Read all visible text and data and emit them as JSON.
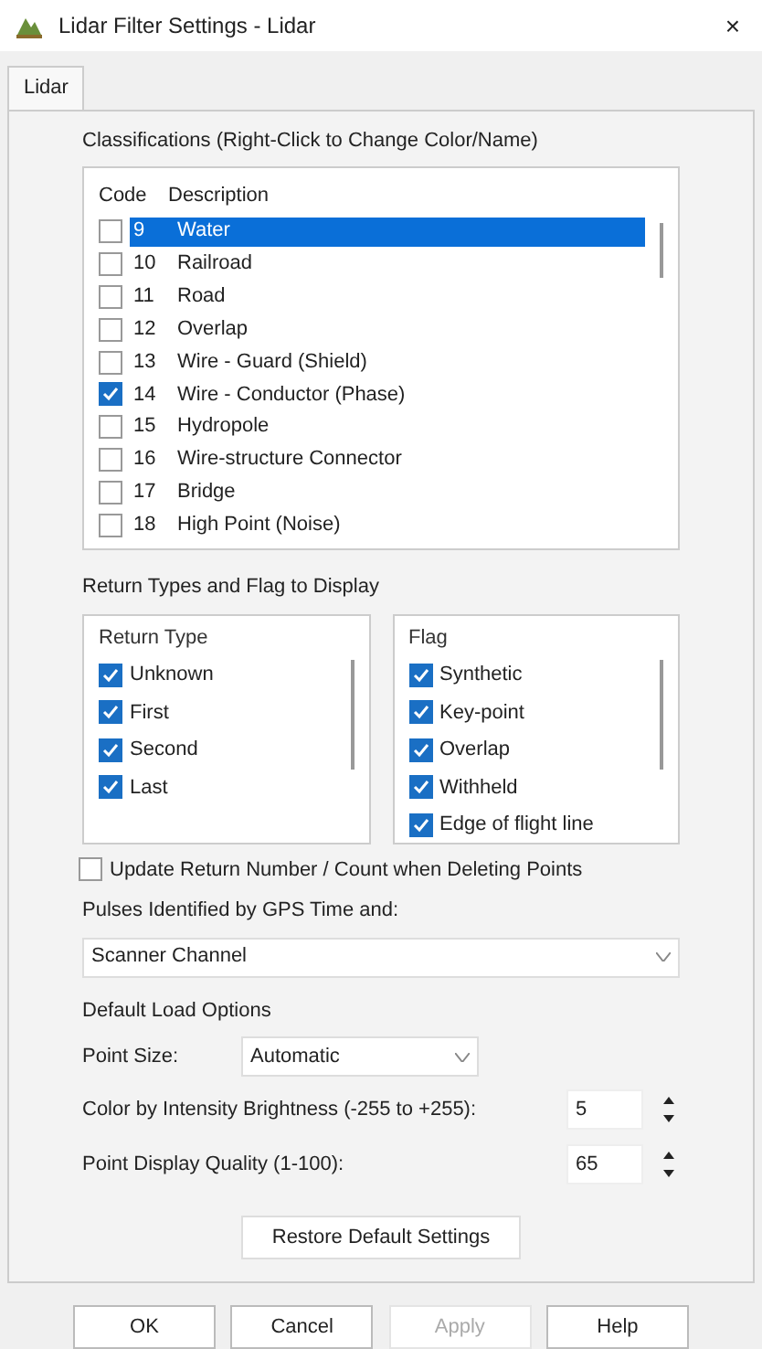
{
  "window": {
    "title": "Lidar Filter Settings - Lidar",
    "close": "×"
  },
  "tab": {
    "label": "Lidar"
  },
  "classifications": {
    "label": "Classifications (Right-Click to Change Color/Name)",
    "columns": [
      "Code",
      "Description"
    ],
    "rows": [
      {
        "code": "9",
        "description": "Water",
        "checked": false,
        "selected": true
      },
      {
        "code": "10",
        "description": "Railroad",
        "checked": false,
        "selected": false
      },
      {
        "code": "11",
        "description": "Road",
        "checked": false,
        "selected": false
      },
      {
        "code": "12",
        "description": "Overlap",
        "checked": false,
        "selected": false
      },
      {
        "code": "13",
        "description": "Wire - Guard (Shield)",
        "checked": false,
        "selected": false
      },
      {
        "code": "14",
        "description": "Wire - Conductor (Phase)",
        "checked": true,
        "selected": false
      },
      {
        "code": "15",
        "description": "Hydropole",
        "checked": false,
        "selected": false
      },
      {
        "code": "16",
        "description": "Wire-structure Connector",
        "checked": false,
        "selected": false
      },
      {
        "code": "17",
        "description": "Bridge",
        "checked": false,
        "selected": false
      },
      {
        "code": "18",
        "description": "High Point (Noise)",
        "checked": false,
        "selected": false
      }
    ]
  },
  "return_section": {
    "label": "Return Types and Flag to Display",
    "return_types": {
      "header": "Return Type",
      "items": [
        {
          "label": "Unknown",
          "checked": true
        },
        {
          "label": "First",
          "checked": true
        },
        {
          "label": "Second",
          "checked": true
        },
        {
          "label": "Last",
          "checked": true
        }
      ]
    },
    "flags": {
      "header": "Flag",
      "items": [
        {
          "label": "Synthetic",
          "checked": true
        },
        {
          "label": "Key-point",
          "checked": true
        },
        {
          "label": "Overlap",
          "checked": true
        },
        {
          "label": "Withheld",
          "checked": true
        },
        {
          "label": "Edge of flight line",
          "checked": true
        }
      ]
    }
  },
  "update_checkbox": {
    "label": "Update Return Number / Count when Deleting Points",
    "checked": false
  },
  "pulses": {
    "label": "Pulses Identified by GPS Time and:",
    "value": "Scanner Channel"
  },
  "load_options": {
    "label": "Default Load Options",
    "point_size": {
      "label": "Point Size:",
      "value": "Automatic"
    },
    "brightness": {
      "label": "Color by Intensity Brightness (-255 to +255):",
      "value": "5"
    },
    "quality": {
      "label": "Point Display Quality (1-100):",
      "value": "65"
    }
  },
  "restore_button": "Restore Default Settings",
  "buttons": [
    {
      "label": "OK",
      "disabled": false
    },
    {
      "label": "Cancel",
      "disabled": false
    },
    {
      "label": "Apply",
      "disabled": true
    },
    {
      "label": "Help",
      "disabled": false
    }
  ]
}
